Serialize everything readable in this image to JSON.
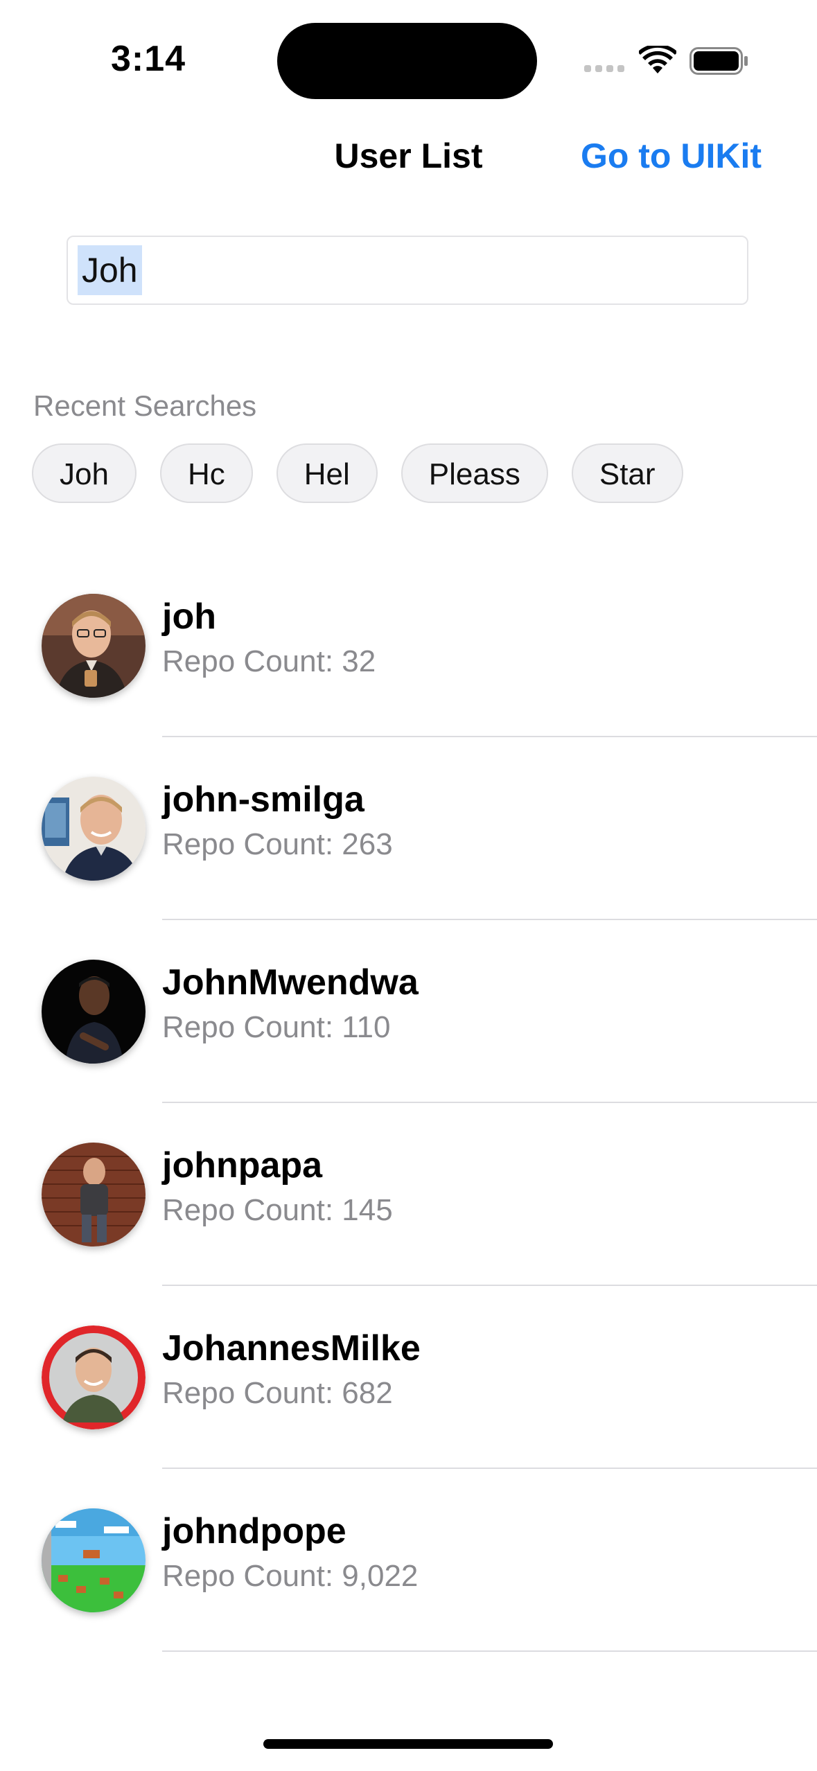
{
  "status_bar": {
    "time": "3:14"
  },
  "nav": {
    "title": "User List",
    "action_label": "Go to UIKit",
    "accent_color": "#1a7cf0"
  },
  "search": {
    "value": "Joh"
  },
  "recent": {
    "title": "Recent Searches",
    "chips": [
      "Joh",
      "Hc",
      "Hel",
      "Pleass",
      "Star"
    ]
  },
  "users": [
    {
      "name": "joh",
      "repos": "Repo Count: 32",
      "avatar_icon": "avatar-photo"
    },
    {
      "name": "john-smilga",
      "repos": "Repo Count: 263",
      "avatar_icon": "avatar-photo"
    },
    {
      "name": "JohnMwendwa",
      "repos": "Repo Count: 110",
      "avatar_icon": "avatar-photo"
    },
    {
      "name": "johnpapa",
      "repos": "Repo Count: 145",
      "avatar_icon": "avatar-photo"
    },
    {
      "name": "JohannesMilke",
      "repos": "Repo Count: 682",
      "avatar_icon": "avatar-photo"
    },
    {
      "name": "johndpope",
      "repos": "Repo Count: 9,022",
      "avatar_icon": "avatar-game-scene"
    }
  ]
}
